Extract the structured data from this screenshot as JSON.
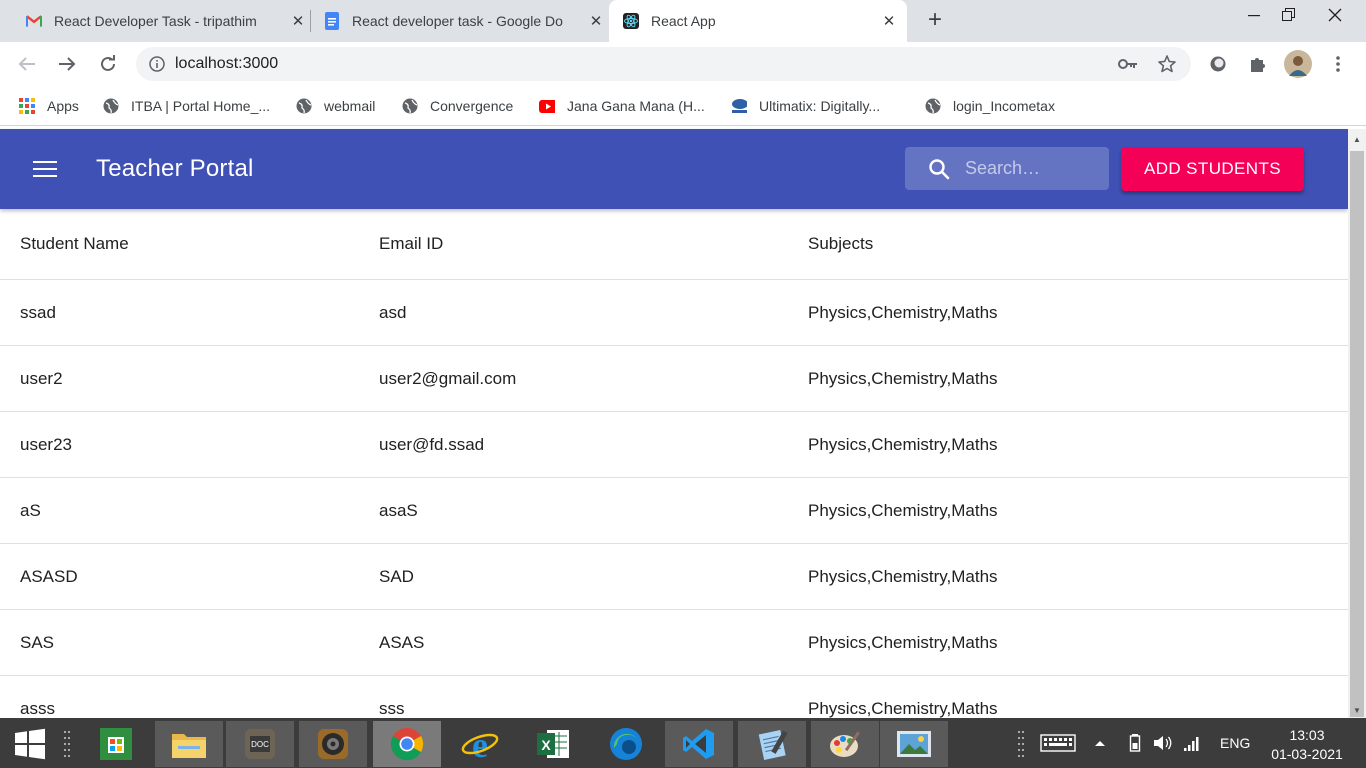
{
  "browser": {
    "tabs": [
      {
        "title": "React Developer Task - tripathim",
        "icon": "gmail-icon"
      },
      {
        "title": "React developer task - Google Do",
        "icon": "google-docs-icon"
      },
      {
        "title": "React App",
        "icon": "react-icon"
      }
    ],
    "address": "localhost:3000",
    "bookmarks": [
      "Apps",
      "ITBA | Portal Home_...",
      "webmail",
      "Convergence",
      "Jana Gana Mana (H...",
      "Ultimatix: Digitally...",
      "login_Incometax"
    ]
  },
  "app": {
    "title": "Teacher Portal",
    "search_placeholder": "Search…",
    "add_button": "ADD STUDENTS",
    "primary_color": "#3f51b5",
    "accent_color": "#f50057"
  },
  "table": {
    "headers": [
      "Student Name",
      "Email ID",
      "Subjects"
    ],
    "rows": [
      [
        "ssad",
        "asd",
        "Physics,Chemistry,Maths"
      ],
      [
        "user2",
        "user2@gmail.com",
        "Physics,Chemistry,Maths"
      ],
      [
        "user23",
        "user@fd.ssad",
        "Physics,Chemistry,Maths"
      ],
      [
        "aS",
        "asaS",
        "Physics,Chemistry,Maths"
      ],
      [
        "ASASD",
        "SAD",
        "Physics,Chemistry,Maths"
      ],
      [
        "SAS",
        "ASAS",
        "Physics,Chemistry,Maths"
      ],
      [
        "asss",
        "sss",
        "Physics,Chemistry,Maths"
      ]
    ]
  },
  "taskbar": {
    "language": "ENG",
    "time": "13:03",
    "date": "01-03-2021"
  }
}
